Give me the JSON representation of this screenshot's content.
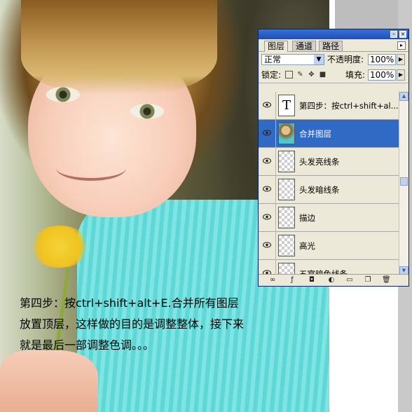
{
  "panel": {
    "tabs": [
      {
        "label": "图层",
        "active": true
      },
      {
        "label": "通道",
        "active": false
      },
      {
        "label": "路径",
        "active": false
      }
    ],
    "menu_icon": "palette-menu-icon",
    "blend_mode": "正常",
    "opacity_label": "不透明度:",
    "opacity_value": "100%",
    "lock_label": "锁定:",
    "fill_label": "填充:",
    "fill_value": "100%",
    "layers": [
      {
        "name": "第四步：按ctrl+shift+al...",
        "type": "text",
        "visible": true,
        "selected": false
      },
      {
        "name": "合并图层",
        "type": "image",
        "visible": true,
        "selected": true
      },
      {
        "name": "头发亮线条",
        "type": "transparent",
        "visible": true,
        "selected": false
      },
      {
        "name": "头发暗线条",
        "type": "transparent",
        "visible": true,
        "selected": false
      },
      {
        "name": "描边",
        "type": "transparent",
        "visible": true,
        "selected": false
      },
      {
        "name": "高光",
        "type": "transparent",
        "visible": true,
        "selected": false
      },
      {
        "name": "五官暗色线条",
        "type": "transparent",
        "visible": true,
        "selected": false
      }
    ],
    "bottom_icons": [
      "link-icon",
      "layer-style-icon",
      "mask-icon",
      "adjustment-layer-icon",
      "new-group-icon",
      "new-layer-icon",
      "trash-icon"
    ],
    "selection_color": "#316ac5"
  },
  "caption": {
    "line1": "第四步：按ctrl+shift+alt+E.合并所有图层",
    "line2": "放置顶层，这样做的目的是调整整体，接下来",
    "line3": "就是最后一部调整色调。。。"
  }
}
